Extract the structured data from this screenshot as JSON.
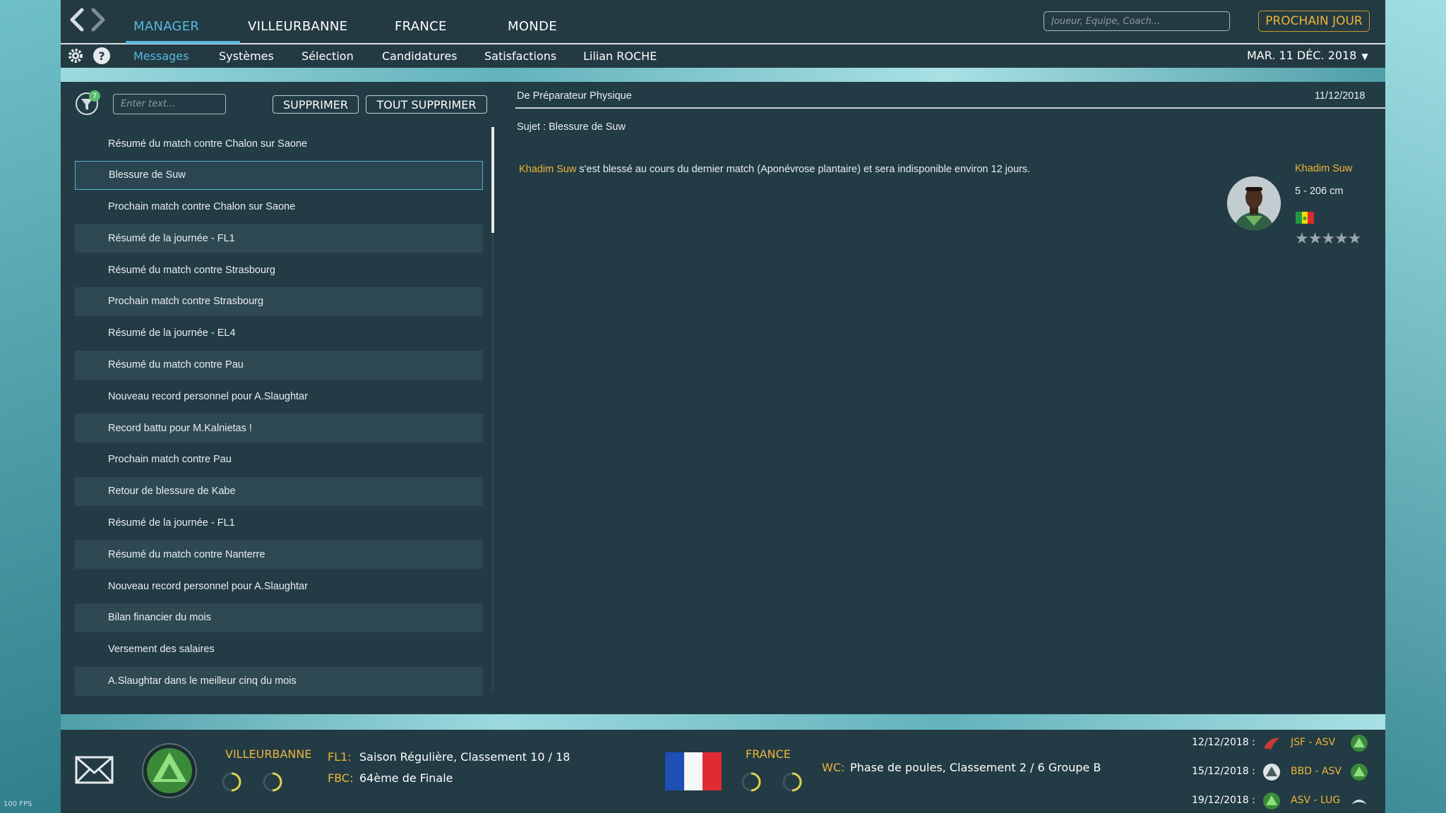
{
  "nav": {
    "back_icon": "chevron-left-icon",
    "forward_icon": "chevron-right-icon",
    "tabs": [
      "MANAGER",
      "VILLEURBANNE",
      "FRANCE",
      "MONDE"
    ],
    "active_tab": "MANAGER",
    "search_placeholder": "Joueur, Equipe, Coach...",
    "next_day_label": "PROCHAIN JOUR"
  },
  "subnav": {
    "settings_icon": "gear-icon",
    "help_icon": "help-icon",
    "items": [
      "Messages",
      "Systèmes",
      "Sélection",
      "Candidatures",
      "Satisfactions",
      "Lilian ROCHE"
    ],
    "active_item": "Messages",
    "date": "MAR. 11 DÉC. 2018"
  },
  "inbox": {
    "filter_badge": "7",
    "filter_placeholder": "Enter text...",
    "delete_label": "SUPPRIMER",
    "delete_all_label": "TOUT SUPPRIMER",
    "messages": [
      "Résumé du match contre Chalon sur Saone",
      "Blessure de Suw",
      "Prochain match contre Chalon sur Saone",
      "Résumé de la journée - FL1",
      "Résumé du match contre Strasbourg",
      "Prochain match contre Strasbourg",
      "Résumé de la journée - EL4",
      "Résumé du match contre Pau",
      "Nouveau record personnel pour A.Slaughtar",
      "Record battu pour M.Kalnietas !",
      "Prochain match contre Pau",
      "Retour de blessure de Kabe",
      "Résumé de la journée - FL1",
      "Résumé du match contre Nanterre",
      "Nouveau record personnel pour A.Slaughtar",
      "Bilan financier du mois",
      "Versement des salaires",
      "A.Slaughtar dans le meilleur cinq du mois"
    ],
    "selected_index": 1
  },
  "message": {
    "from": "De Préparateur Physique",
    "date": "11/12/2018",
    "subject": "Sujet : Blessure de Suw",
    "body_player": "Khadim Suw",
    "body_text": " s'est blessé au cours du dernier match (Aponévrose plantaire) et sera indisponible environ 12 jours.",
    "player": {
      "name": "Khadim Suw",
      "info": "5 - 206 cm",
      "rating_stars": 5,
      "stars_text": "★★★★★",
      "flag": "senegal-flag"
    }
  },
  "footer": {
    "mail_icon": "envelope-icon",
    "club": "VILLEURBANNE",
    "competitions": [
      {
        "label": "FL1:",
        "text": "Saison Régulière, Classement 10 / 18"
      },
      {
        "label": "FBC:",
        "text": "64ème de Finale"
      }
    ],
    "nation": "FRANCE",
    "nation_comp": {
      "label": "WC:",
      "text": "Phase de poules, Classement 2 / 6 Groupe B"
    },
    "fixtures": [
      {
        "date": "12/12/2018 :",
        "teams": "JSF - ASV"
      },
      {
        "date": "15/12/2018 :",
        "teams": "BBD - ASV"
      },
      {
        "date": "19/12/2018 :",
        "teams": "ASV - LUG"
      }
    ],
    "fps": "100 FPS"
  },
  "colors": {
    "accent_blue": "#5ab7e0",
    "accent_gold": "#f0b43a",
    "panel": "#223b44",
    "row_alt": "#2e4952"
  }
}
